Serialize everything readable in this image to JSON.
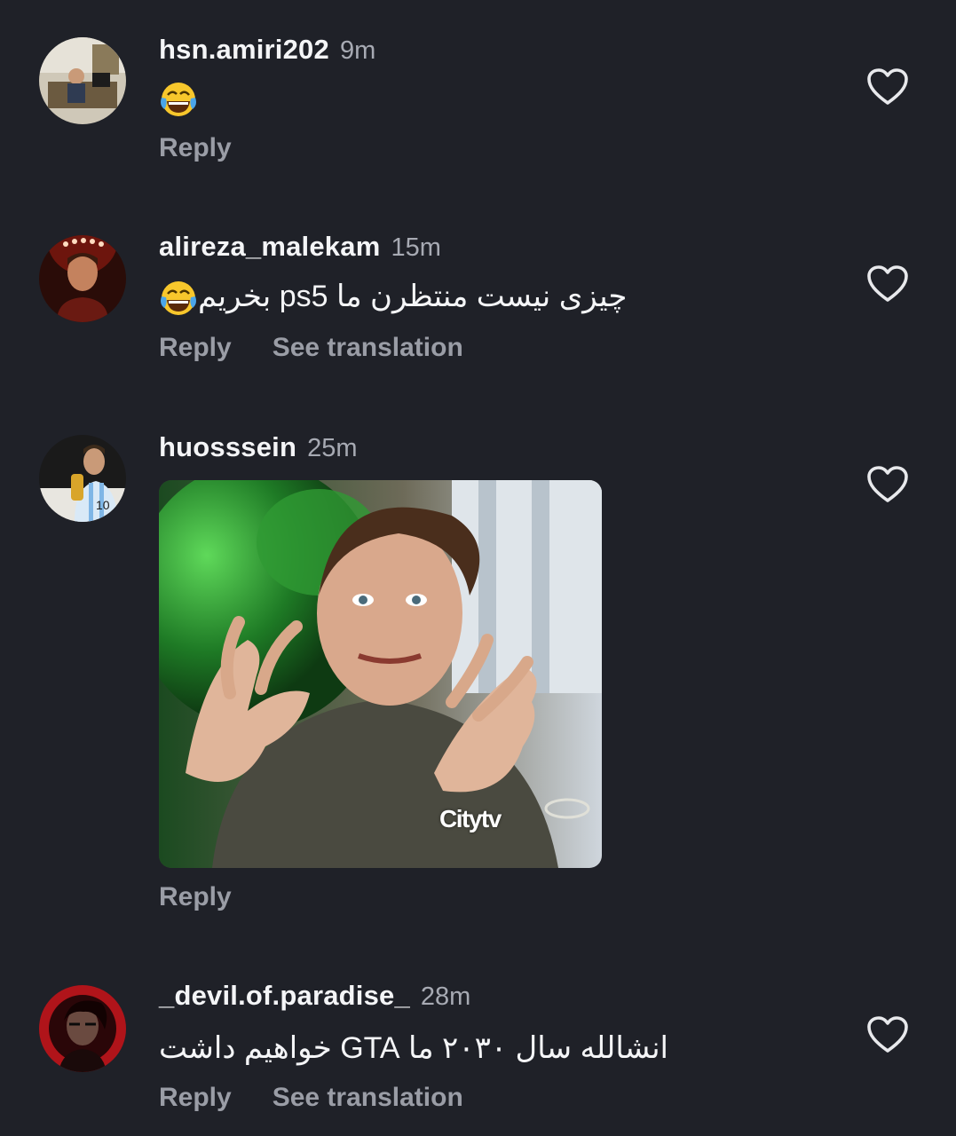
{
  "comments": [
    {
      "username": "hsn.amiri202",
      "time": "9m",
      "text": "",
      "emoji": "face-with-tears-of-joy",
      "actions": [
        "Reply"
      ],
      "liked": false
    },
    {
      "username": "alireza_malekam",
      "time": "15m",
      "text": "چیزی نیست منتظرن ما ps5 بخریم",
      "emoji": "face-with-tears-of-joy",
      "actions": [
        "Reply",
        "See translation"
      ],
      "liked": false
    },
    {
      "username": "huosssein",
      "time": "25m",
      "gif_watermark": "Citytv",
      "actions": [
        "Reply"
      ],
      "liked": false
    },
    {
      "username": "_devil.of.paradise_",
      "time": "28m",
      "text": "انشالله سال ۲۰۳۰ ما GTA خواهیم داشت",
      "actions": [
        "Reply",
        "See translation"
      ],
      "liked": false
    }
  ],
  "icons": {
    "like": "heart-outline-icon",
    "emoji": "face-with-tears-of-joy-emoji"
  },
  "colors": {
    "background": "#1f2128",
    "username": "#f4f5f7",
    "secondary_text": "#a7aab3",
    "action_text": "#9a9da6"
  }
}
